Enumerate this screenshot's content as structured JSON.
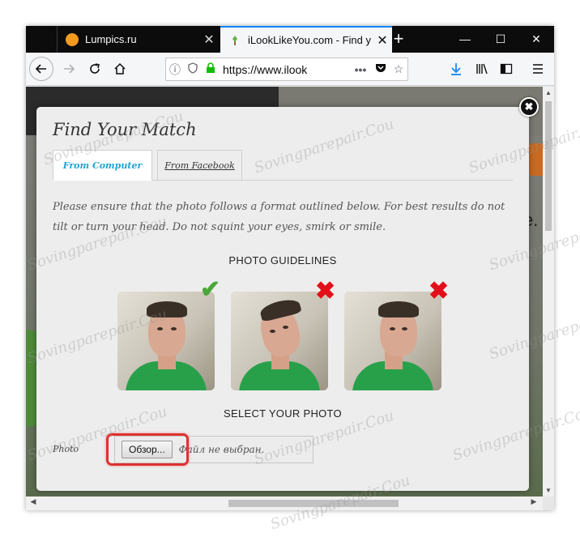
{
  "browser": {
    "tabs": [
      {
        "title": "Lumpics.ru",
        "active": false
      },
      {
        "title": "iLookLikeYou.com - Find y",
        "active": true
      }
    ],
    "new_tab": "+",
    "window_buttons": {
      "minimize": "—",
      "maximize": "☐",
      "close": "✕"
    },
    "url": "https://www.ilook",
    "url_menu": "•••",
    "icons": [
      "back-icon",
      "forward-icon",
      "reload-icon",
      "home-icon",
      "info-icon",
      "shield-icon",
      "lock-icon",
      "pocket-icon",
      "star-icon",
      "download-icon",
      "library-icon",
      "sidebar-icon",
      "menu-icon"
    ]
  },
  "page": {
    "background_letter": "e."
  },
  "modal": {
    "title": "Find Your Match",
    "close": "✖",
    "tabs": [
      {
        "label": "From Computer",
        "active": true
      },
      {
        "label": "From Facebook",
        "active": false
      }
    ],
    "instructions": "Please ensure that the photo follows a format outlined below. For best results do not tilt or turn your head. Do not squint your eyes, smirk or smile.",
    "guidelines_heading": "PHOTO GUIDELINES",
    "photos": [
      {
        "status": "correct",
        "mark": "✔"
      },
      {
        "status": "incorrect",
        "mark": "✖"
      },
      {
        "status": "incorrect",
        "mark": "✖"
      }
    ],
    "select_heading": "SELECT YOUR PHOTO",
    "photo_label": "Photo",
    "browse_button": "Обзор...",
    "no_file_text": "Файл не выбран."
  },
  "watermark": "Sovingparepair.Cou",
  "colors": {
    "accent_tab": "#1fa3d6",
    "highlight": "#e03030",
    "check": "#4aa638",
    "cross": "#e1101a"
  }
}
